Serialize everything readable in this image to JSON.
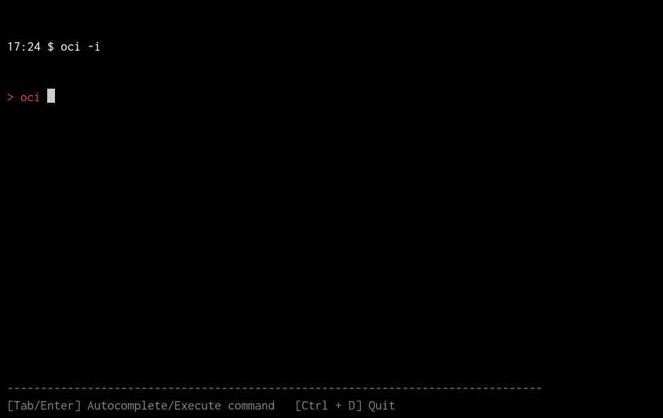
{
  "prompt_line": {
    "time": "17:24",
    "symbol": "$",
    "command": "oci -i"
  },
  "repl_line": {
    "prompt": ">",
    "input": "oci"
  },
  "separator": "--------------------------------------------------------------------------------",
  "footer": {
    "hint1_key": "[Tab/Enter]",
    "hint1_desc": "Autocomplete/Execute command",
    "hint2_key": "[Ctrl + D]",
    "hint2_desc": "Quit"
  }
}
